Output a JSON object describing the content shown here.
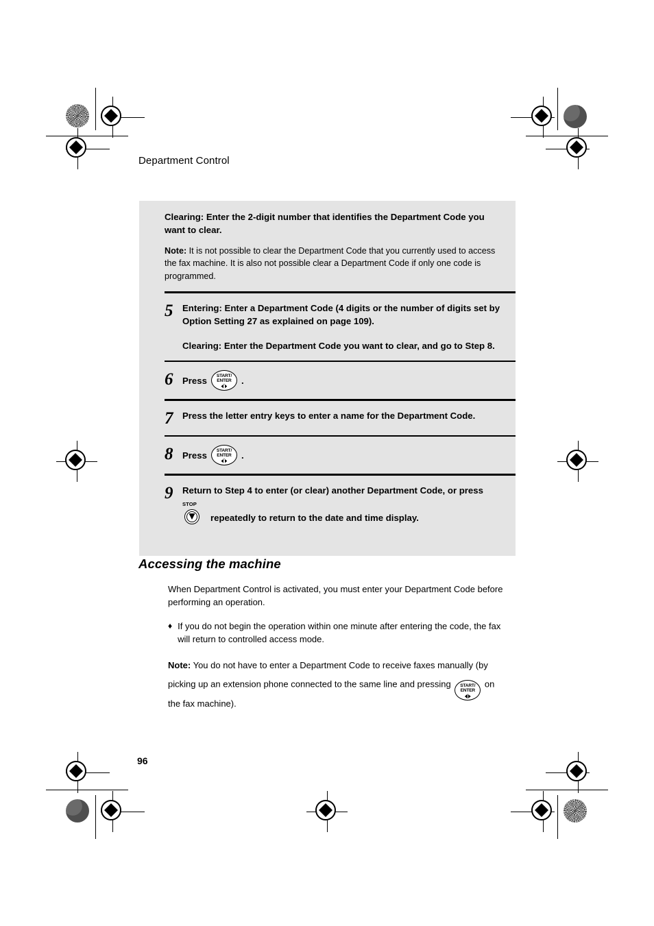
{
  "document": {
    "running_head": "Department Control",
    "page_number": "96"
  },
  "step_box": {
    "intro": {
      "heading": "Clearing: Enter the 2-digit number that identifies the Department Code you want to clear.",
      "note_label": "Note:",
      "note_text": " It is not possible to clear the Department Code that you currently used to access the fax machine. It is also not possible clear a Department Code if only one code is programmed."
    },
    "steps": [
      {
        "number": "5",
        "paragraphs": [
          "Entering: Enter a Department Code (4 digits or the number of digits set by Option Setting 27 as explained on page 109).",
          "Clearing: Enter the Department Code you want to clear, and go to Step 8."
        ]
      },
      {
        "number": "6",
        "press_label": "Press",
        "key": "start-enter",
        "trailing": "."
      },
      {
        "number": "7",
        "paragraphs": [
          "Press the letter entry keys to enter a name for the Department Code."
        ]
      },
      {
        "number": "8",
        "press_label": "Press",
        "key": "start-enter",
        "trailing": "."
      },
      {
        "number": "9",
        "line1": "Return to Step 4 to enter (or clear) another Department Code, or press",
        "key": "stop",
        "line2": "repeatedly to return to the date and time display."
      }
    ]
  },
  "keys": {
    "start_enter": {
      "line1": "START/",
      "line2": "ENTER",
      "icon": "power-diamond-icon"
    },
    "stop": {
      "label": "STOP",
      "icon": "stop-triangle-icon"
    }
  },
  "section": {
    "title": "Accessing the machine",
    "paragraph1": "When Department Control is activated, you must enter your Department Code before performing an operation.",
    "bullet_mark": "♦",
    "bullet1": "If you do not begin the operation within one minute after entering the code, the fax will return to controlled access mode.",
    "note_label": "Note:",
    "note_part1": " You do not have to enter a Department Code to receive faxes manually (by picking up an extension phone connected to the same line and pressing ",
    "note_part2": " on the fax machine)."
  },
  "colors": {
    "box_background": "#e4e4e4",
    "rule": "#000000",
    "text": "#000000",
    "registration_solid": "#5c5c5c"
  }
}
